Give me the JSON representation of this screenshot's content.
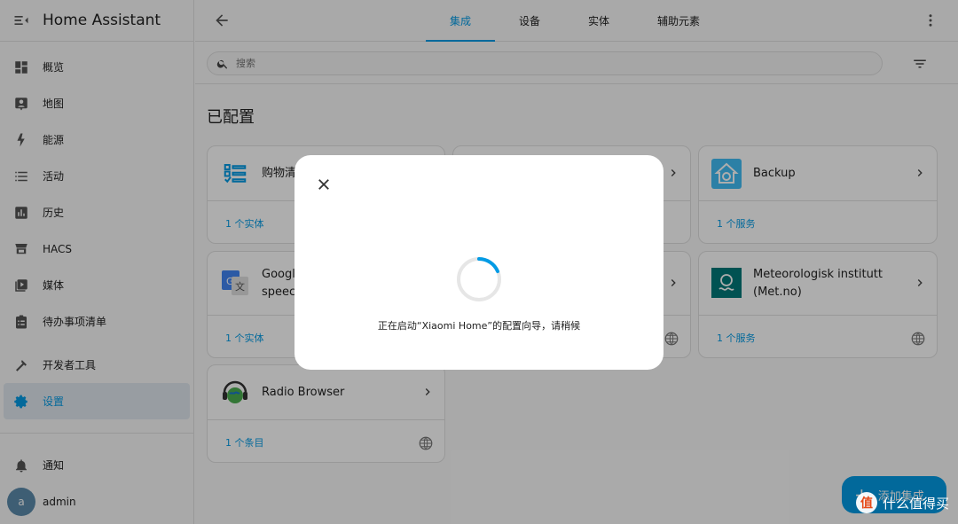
{
  "sidebar": {
    "title": "Home Assistant",
    "items": [
      {
        "label": "概览",
        "icon": "dashboard-icon"
      },
      {
        "label": "地图",
        "icon": "map-icon"
      },
      {
        "label": "能源",
        "icon": "lightning-icon"
      },
      {
        "label": "活动",
        "icon": "list-icon"
      },
      {
        "label": "历史",
        "icon": "chart-icon"
      },
      {
        "label": "HACS",
        "icon": "hacs-icon"
      },
      {
        "label": "媒体",
        "icon": "media-icon"
      },
      {
        "label": "待办事项清单",
        "icon": "clipboard-icon"
      }
    ],
    "dev_tools": "开发者工具",
    "settings": "设置",
    "notifications": "通知",
    "user": {
      "name": "admin",
      "initial": "a"
    }
  },
  "tabs": [
    "集成",
    "设备",
    "实体",
    "辅助元素"
  ],
  "search": {
    "placeholder": "搜索"
  },
  "section_title": "已配置",
  "cards": [
    {
      "name": "购物清",
      "footer": "1 个实体"
    },
    {
      "name": "Backup",
      "footer": "1 个服务"
    },
    {
      "name": "Googl\nspeec",
      "footer": "1 个实体"
    },
    {
      "name": "Meteorologisk institutt\n(Met.no)",
      "footer": "1 个服务"
    },
    {
      "name": "Radio Browser",
      "footer": "1 个条目"
    }
  ],
  "dialog": {
    "message": "正在启动“Xiaomi Home”的配置向导，请稍候"
  },
  "fab": {
    "label": "添加集成"
  },
  "watermark": {
    "text": "什么值得买",
    "badge": "值"
  },
  "colors": {
    "accent": "#039be5",
    "overlay": "rgba(0,0,0,0.32)"
  }
}
